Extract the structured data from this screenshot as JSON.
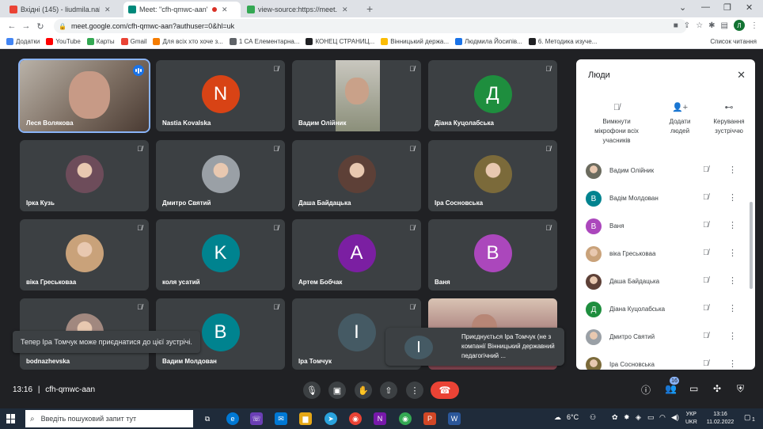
{
  "browser": {
    "tabs": [
      {
        "title": "Вхідні (145) - liudmila.nakonechna",
        "color": "#ea4335"
      },
      {
        "title": "Meet: \"cfh-qmwc-aan\"",
        "color": "#00897b"
      },
      {
        "title": "view-source:https://meet.google.com",
        "color": "#34a853"
      }
    ],
    "url": "meet.google.com/cfh-qmwc-aan?authuser=0&hl=uk",
    "profile_initial": "Л",
    "bookmarks": [
      "Додатки",
      "YouTube",
      "Карты",
      "Gmail",
      "Для всіх хто хоче з...",
      "1 СА Елементарна...",
      "КОНЕЦ СТРАНИЦ...",
      "Вінницький держа...",
      "Людмила Йосипів...",
      "6. Методика изуче..."
    ],
    "bookmarks_right": "Список читання"
  },
  "tiles": [
    {
      "name": "Леся Волякова",
      "type": "photo",
      "color": "#8a7a6b"
    },
    {
      "name": "Nastia Kovalska",
      "type": "letter",
      "letter": "N",
      "color": "#d84315"
    },
    {
      "name": "Вадим Олійник",
      "type": "video",
      "color": "#8b8f7a"
    },
    {
      "name": "Діана Куцолабська",
      "type": "letter",
      "letter": "Д",
      "color": "#1e8e3e"
    },
    {
      "name": "Ірка Кузь",
      "type": "photo",
      "color": "#6d4c5a"
    },
    {
      "name": "Дмитро Святий",
      "type": "photo",
      "color": "#9aa0a6"
    },
    {
      "name": "Даша Байдацька",
      "type": "photo",
      "color": "#5d4037"
    },
    {
      "name": "Іра Сосновська",
      "type": "photo",
      "color": "#7b6a3a"
    },
    {
      "name": "віка Греськоваа",
      "type": "photo",
      "color": "#c9a27a"
    },
    {
      "name": "коля усатий",
      "type": "letter",
      "letter": "K",
      "color": "#00838f"
    },
    {
      "name": "Артем Бобчак",
      "type": "letter",
      "letter": "A",
      "color": "#7b1fa2"
    },
    {
      "name": "Ваня",
      "type": "letter",
      "letter": "B",
      "color": "#ab47bc"
    },
    {
      "name": "bodnazhevska",
      "type": "photo",
      "color": "#a1887f"
    },
    {
      "name": "Вадим Молдован",
      "type": "letter",
      "letter": "B",
      "color": "#00838f"
    },
    {
      "name": "Іра Томчук",
      "type": "letter",
      "letter": "І",
      "color": "#455a64"
    },
    {
      "name": "",
      "type": "video",
      "color": "#7a3f4a"
    }
  ],
  "toast": "Тепер Іра Томчук може приєднатися до цієї зустрічі.",
  "join_popup": {
    "initial": "І",
    "text": "Приєднується Іра Томчук (не з компанії Вінницький державний педагогічний ..."
  },
  "bottombar": {
    "time": "13:16",
    "separator": "|",
    "code": "cfh-qmwc-aan",
    "people_count": "16"
  },
  "panel": {
    "title": "Люди",
    "actions": [
      {
        "label": "Вимкнути мікрофони всіх учасників"
      },
      {
        "label": "Додати людей"
      },
      {
        "label": "Керування зустріччю"
      }
    ],
    "participants": [
      {
        "name": "Вадим Олійник",
        "type": "photo",
        "initial": "",
        "color": "#6b6b5e"
      },
      {
        "name": "Вадім Молдован",
        "type": "letter",
        "initial": "B",
        "color": "#00838f"
      },
      {
        "name": "Ваня",
        "type": "letter",
        "initial": "B",
        "color": "#ab47bc"
      },
      {
        "name": "віка Греськоваа",
        "type": "photo",
        "initial": "",
        "color": "#c9a27a"
      },
      {
        "name": "Даша Байдацька",
        "type": "photo",
        "initial": "",
        "color": "#5d4037"
      },
      {
        "name": "Діана Куцолабська",
        "type": "letter",
        "initial": "Д",
        "color": "#1e8e3e"
      },
      {
        "name": "Дмитро Святий",
        "type": "photo",
        "initial": "",
        "color": "#9aa0a6"
      },
      {
        "name": "Іра Сосновська",
        "type": "photo",
        "initial": "",
        "color": "#7b6a3a"
      }
    ]
  },
  "taskbar": {
    "search_placeholder": "Введіть пошуковий запит тут",
    "weather": "6°C",
    "lang": "УКР",
    "lang2": "UKR",
    "time": "13:16",
    "date": "11.02.2022",
    "notif_count": "1"
  }
}
